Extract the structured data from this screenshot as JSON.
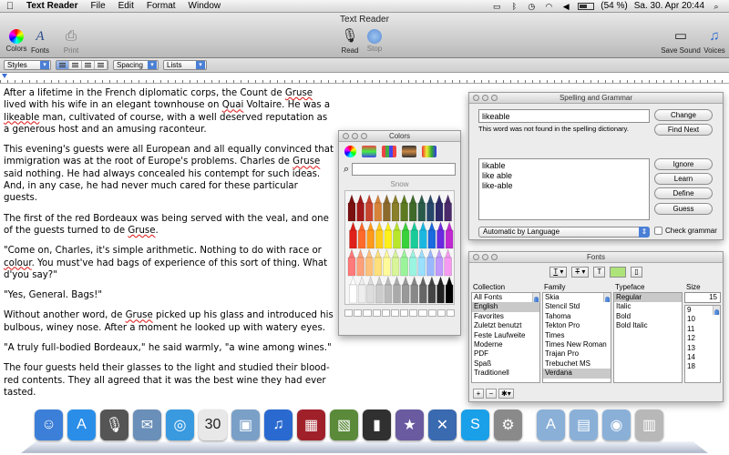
{
  "menubar": {
    "apple_icon": "apple-logo",
    "app_name": "Text Reader",
    "menus": [
      "File",
      "Edit",
      "Format",
      "Window"
    ],
    "battery": "(54 %)",
    "datetime": "Sa. 30. Apr  20:44"
  },
  "window": {
    "title": "Text Reader",
    "toolbar": {
      "colors": "Colors",
      "fonts": "Fonts",
      "print": "Print",
      "read": "Read",
      "stop": "Stop",
      "save_sound": "Save Sound",
      "voices": "Voices"
    }
  },
  "formatbar": {
    "styles": "Styles",
    "spacing": "Spacing",
    "lists": "Lists"
  },
  "document": {
    "paragraphs": [
      [
        "After a lifetime in the French diplomatic corps, the Count de ",
        {
          "w": "Gruse"
        },
        " lived with his wife in an elegant townhouse on ",
        {
          "w": "Quai"
        },
        " Voltaire. He was a ",
        {
          "w": "likeable"
        },
        " man, cultivated of course, with a well deserved reputation as a generous host and an amusing raconteur."
      ],
      [
        "This evening's guests were all European and all equally convinced that immigration was at the root of Europe's problems. Charles de ",
        {
          "w": "Gruse"
        },
        " said nothing. He had always concealed his contempt for such ideas. And, in any case, he had never much cared for these particular guests."
      ],
      [
        "The first of the red Bordeaux was being served with the veal, and one of the guests turned to de ",
        {
          "w": "Gruse"
        },
        "."
      ],
      [
        "\"Come on, Charles, it's simple arithmetic. Nothing to do with race or ",
        {
          "w": "colour"
        },
        ". You must've had bags of experience of this sort of thing. What d'you say?\""
      ],
      [
        "\"Yes, General. Bags!\""
      ],
      [
        "Without another word, de ",
        {
          "w": "Gruse"
        },
        " picked up his glass and introduced his bulbous, winey nose. After a moment he looked up with watery eyes."
      ],
      [
        "\"A truly full-bodied Bordeaux,\" he said warmly, \"a wine among wines.\""
      ],
      [
        "The four guests held their glasses to the light and studied their blood-red contents. They all agreed that it was the best wine they had ever tasted."
      ]
    ]
  },
  "colors_panel": {
    "title": "Colors",
    "crayon_name": "Snow",
    "crayon_colors": [
      [
        "#7a1010",
        "#a31818",
        "#c8442e",
        "#d8833a",
        "#8c6a2c",
        "#8a7f2a",
        "#5d7a20",
        "#3f6a2a",
        "#2a5a4a",
        "#27476a",
        "#2e2a6a",
        "#4a2a6a"
      ],
      [
        "#e0201a",
        "#ff6a2a",
        "#ff9a1a",
        "#ffcc1a",
        "#fff01a",
        "#b8e62a",
        "#3ad23a",
        "#1acc9a",
        "#1ab8e0",
        "#1a6ae0",
        "#6a2ae0",
        "#c02ad0"
      ],
      [
        "#ff7a7a",
        "#ffa07a",
        "#ffc07a",
        "#ffe07a",
        "#fffa9a",
        "#d8f59a",
        "#9af59a",
        "#9af5e0",
        "#9ae0ff",
        "#9ab8ff",
        "#c09aff",
        "#f59af0"
      ],
      [
        "#ffffff",
        "#eeeeee",
        "#dddddd",
        "#cccccc",
        "#bbbbbb",
        "#aaaaaa",
        "#999999",
        "#888888",
        "#666666",
        "#444444",
        "#222222",
        "#000000"
      ]
    ]
  },
  "spelling_panel": {
    "title": "Spelling and Grammar",
    "word": "likeable",
    "message": "This word was not found in the spelling dictionary.",
    "suggestions": [
      "likable",
      "like able",
      "like-able"
    ],
    "language": "Automatic by Language",
    "check_grammar": "Check grammar",
    "buttons": {
      "change": "Change",
      "find_next": "Find Next",
      "ignore": "Ignore",
      "learn": "Learn",
      "define": "Define",
      "guess": "Guess"
    }
  },
  "fonts_panel": {
    "title": "Fonts",
    "headers": {
      "collection": "Collection",
      "family": "Family",
      "typeface": "Typeface",
      "size": "Size"
    },
    "collections": [
      "All Fonts",
      "English",
      "Favorites",
      "Zuletzt benutzt",
      "Feste Laufweite",
      "Moderne",
      "PDF",
      "Spaß",
      "Traditionell"
    ],
    "collections_selected": 1,
    "families": [
      "Skia",
      "Stencil Std",
      "Tahoma",
      "Tekton Pro",
      "Times",
      "Times New Roman",
      "Trajan Pro",
      "Trebuchet MS",
      "Verdana"
    ],
    "families_selected": 8,
    "typefaces": [
      "Regular",
      "Italic",
      "Bold",
      "Bold Italic"
    ],
    "typefaces_selected": 0,
    "size_value": "15",
    "sizes": [
      "9",
      "10",
      "11",
      "12",
      "13",
      "14",
      "18"
    ],
    "bottom_add": "+",
    "bottom_remove": "−",
    "bottom_action": "✱▾"
  },
  "dock": {
    "items": [
      {
        "name": "finder",
        "color": "#3c7fd8",
        "glyph": "☺"
      },
      {
        "name": "app-store",
        "color": "#2a8ee8",
        "glyph": "A"
      },
      {
        "name": "microphone",
        "color": "#555555",
        "glyph": "🎙"
      },
      {
        "name": "mail",
        "color": "#6a8fb8",
        "glyph": "✉"
      },
      {
        "name": "safari",
        "color": "#3a9ae0",
        "glyph": "◎"
      },
      {
        "name": "calendar",
        "color": "#e8e8e8",
        "glyph": "30"
      },
      {
        "name": "preview",
        "color": "#7aa0c8",
        "glyph": "▣"
      },
      {
        "name": "itunes",
        "color": "#2a6ad0",
        "glyph": "♫"
      },
      {
        "name": "front-row",
        "color": "#a0202a",
        "glyph": "▦"
      },
      {
        "name": "iphoto",
        "color": "#5a8a3a",
        "glyph": "▧"
      },
      {
        "name": "battery-app",
        "color": "#303030",
        "glyph": "▮"
      },
      {
        "name": "imovie",
        "color": "#6a5aa0",
        "glyph": "★"
      },
      {
        "name": "xcode",
        "color": "#3a6ab0",
        "glyph": "✕"
      },
      {
        "name": "skype",
        "color": "#1aa0e8",
        "glyph": "S"
      },
      {
        "name": "system-preferences",
        "color": "#8a8a8a",
        "glyph": "⚙"
      }
    ],
    "folders": [
      {
        "name": "applications-folder",
        "color": "#8ab0d8",
        "glyph": "A"
      },
      {
        "name": "documents-folder",
        "color": "#8ab0d8",
        "glyph": "▤"
      },
      {
        "name": "downloads-folder",
        "color": "#8ab0d8",
        "glyph": "◉"
      },
      {
        "name": "trash",
        "color": "#b8b8b8",
        "glyph": "▥"
      }
    ]
  },
  "colors": {
    "accent": "#4a7fd6",
    "selection": "#c9c9c9",
    "misspelled": "#d11111"
  }
}
